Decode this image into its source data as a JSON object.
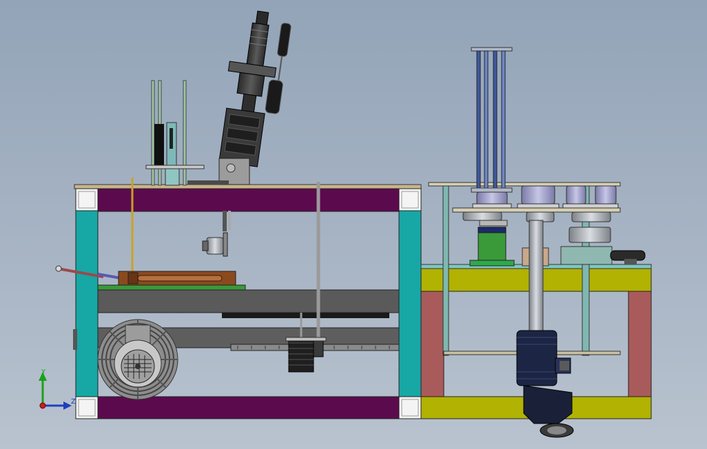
{
  "triad": {
    "y_label": "Y",
    "z_label": "Z"
  },
  "colors": {
    "purple": "#5c0a4e",
    "teal": "#17a7a5",
    "olive": "#b2b203",
    "brick": "#a95b5b",
    "plate": "#c9b48a",
    "dark": "#3b3b3b",
    "green": "#3a9a3a",
    "navy": "#1d2545",
    "brown": "#8b4a1e",
    "blue_rod": "#3f5a9a"
  }
}
